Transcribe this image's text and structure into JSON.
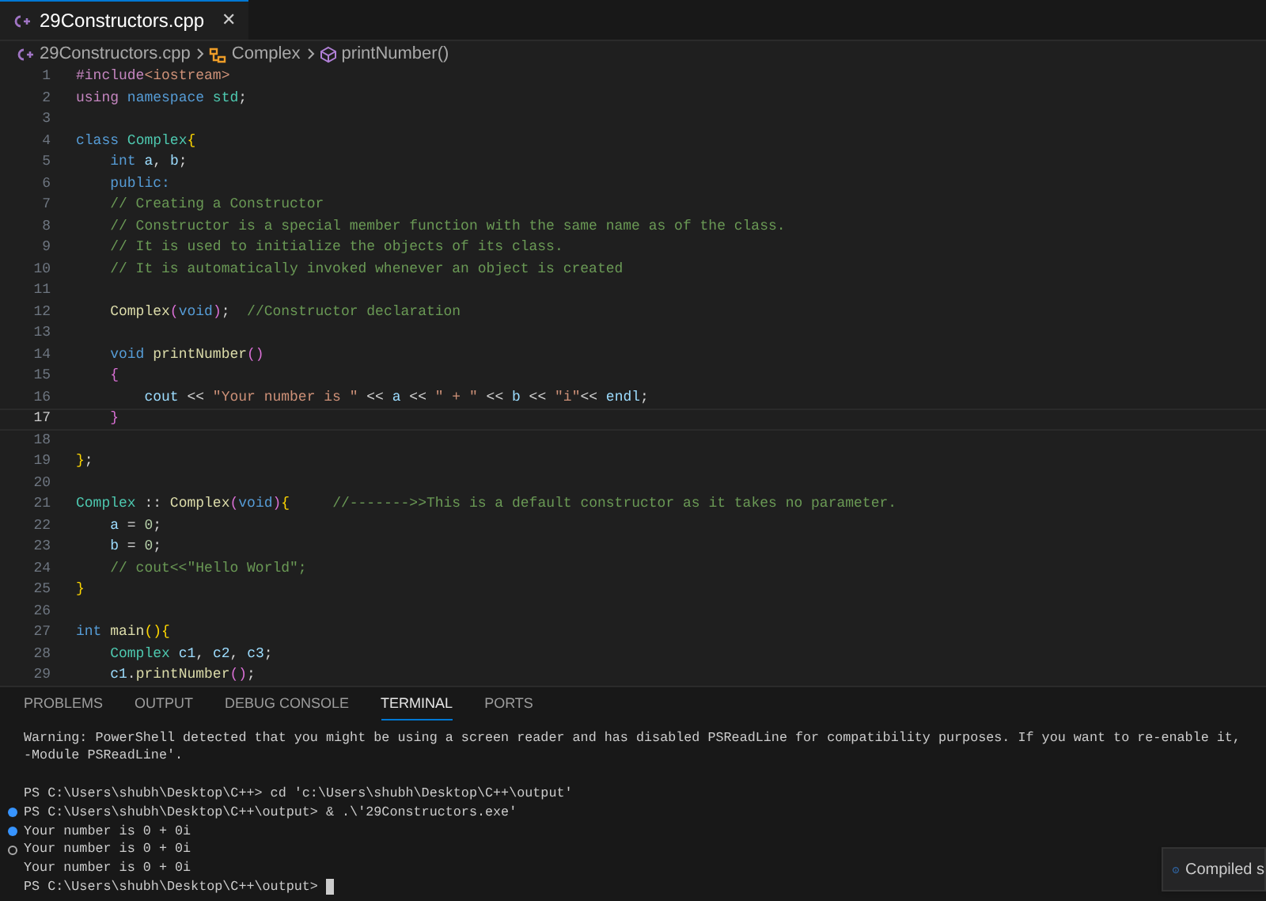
{
  "tab": {
    "label": "29Constructors.cpp",
    "close": "✕",
    "selected": true
  },
  "breadcrumb": [
    {
      "label": "29Constructors.cpp",
      "kind": "file"
    },
    {
      "label": "Complex",
      "kind": "class"
    },
    {
      "label": "printNumber()",
      "kind": "method"
    }
  ],
  "editor": {
    "lines": [
      {
        "number": "1",
        "active": false,
        "tokens": [
          {
            "text": "#include",
            "kind": "control"
          },
          {
            "text": "<iostream>",
            "kind": "string"
          }
        ]
      },
      {
        "number": "2",
        "active": false,
        "tokens": [
          {
            "text": "using",
            "kind": "control"
          },
          {
            "text": " namespace",
            "kind": "keyword"
          },
          {
            "text": " std",
            "kind": "type"
          },
          {
            "text": ";",
            "kind": "plain"
          }
        ]
      },
      {
        "number": "3",
        "active": false
      },
      {
        "number": "4",
        "active": false,
        "tokens": [
          {
            "text": "class",
            "kind": "keyword"
          },
          {
            "text": " Complex",
            "kind": "type"
          },
          {
            "text": "{",
            "kind": "bracket"
          }
        ]
      },
      {
        "number": "5",
        "active": false,
        "tokens": [
          {
            "text": "    int",
            "kind": "keyword"
          },
          {
            "text": " a",
            "kind": "var"
          },
          {
            "text": ", ",
            "kind": "plain"
          },
          {
            "text": "b",
            "kind": "var"
          },
          {
            "text": ";",
            "kind": "plain"
          }
        ]
      },
      {
        "number": "6",
        "active": false,
        "tokens": [
          {
            "text": "    public:",
            "kind": "keyword"
          }
        ]
      },
      {
        "number": "7",
        "active": false,
        "tokens": [
          {
            "text": "    // Creating a Constructor",
            "kind": "comment"
          }
        ]
      },
      {
        "number": "8",
        "active": false,
        "tokens": [
          {
            "text": "    // Constructor is a special member function with the same name as of the class.",
            "kind": "comment"
          }
        ]
      },
      {
        "number": "9",
        "active": false,
        "tokens": [
          {
            "text": "    // It is used to initialize the objects of its class.",
            "kind": "comment"
          }
        ]
      },
      {
        "number": "10",
        "active": false,
        "tokens": [
          {
            "text": "    // It is automatically invoked whenever an object is created",
            "kind": "comment"
          }
        ]
      },
      {
        "number": "11",
        "active": false
      },
      {
        "number": "12",
        "active": false,
        "tokens": [
          {
            "text": "    Complex",
            "kind": "func"
          },
          {
            "text": "(",
            "kind": "bracket2"
          },
          {
            "text": "void",
            "kind": "keyword"
          },
          {
            "text": ")",
            "kind": "bracket2"
          },
          {
            "text": ";  ",
            "kind": "plain"
          },
          {
            "text": "//Constructor declaration",
            "kind": "comment"
          }
        ]
      },
      {
        "number": "13",
        "active": false
      },
      {
        "number": "14",
        "active": false,
        "tokens": [
          {
            "text": "    void",
            "kind": "keyword"
          },
          {
            "text": " printNumber",
            "kind": "func"
          },
          {
            "text": "()",
            "kind": "bracket2"
          }
        ]
      },
      {
        "number": "15",
        "active": false,
        "tokens": [
          {
            "text": "    {",
            "kind": "bracket2"
          }
        ]
      },
      {
        "number": "16",
        "active": false,
        "tokens": [
          {
            "text": "        cout",
            "kind": "var"
          },
          {
            "text": " << ",
            "kind": "plain"
          },
          {
            "text": "\"Your number is \"",
            "kind": "string"
          },
          {
            "text": " << ",
            "kind": "plain"
          },
          {
            "text": "a",
            "kind": "var"
          },
          {
            "text": " << ",
            "kind": "plain"
          },
          {
            "text": "\" + \"",
            "kind": "string"
          },
          {
            "text": " << ",
            "kind": "plain"
          },
          {
            "text": "b",
            "kind": "var"
          },
          {
            "text": " << ",
            "kind": "plain"
          },
          {
            "text": "\"i\"",
            "kind": "string"
          },
          {
            "text": "<< ",
            "kind": "plain"
          },
          {
            "text": "endl",
            "kind": "var"
          },
          {
            "text": ";",
            "kind": "plain"
          }
        ]
      },
      {
        "number": "17",
        "active": true,
        "tokens": [
          {
            "text": "    }",
            "kind": "bracket2"
          }
        ]
      },
      {
        "number": "18",
        "active": false
      },
      {
        "number": "19",
        "active": false,
        "tokens": [
          {
            "text": "}",
            "kind": "bracket"
          },
          {
            "text": ";",
            "kind": "plain"
          }
        ]
      },
      {
        "number": "20",
        "active": false
      },
      {
        "number": "21",
        "active": false,
        "tokens": [
          {
            "text": "Complex",
            "kind": "type"
          },
          {
            "text": " :: ",
            "kind": "plain"
          },
          {
            "text": "Complex",
            "kind": "func"
          },
          {
            "text": "(",
            "kind": "bracket2"
          },
          {
            "text": "void",
            "kind": "keyword"
          },
          {
            "text": ")",
            "kind": "bracket2"
          },
          {
            "text": "{",
            "kind": "bracket"
          },
          {
            "text": "     //------->>This is a default constructor as it takes no parameter.",
            "kind": "comment"
          }
        ]
      },
      {
        "number": "22",
        "active": false,
        "tokens": [
          {
            "text": "    a",
            "kind": "var"
          },
          {
            "text": " = ",
            "kind": "plain"
          },
          {
            "text": "0",
            "kind": "number"
          },
          {
            "text": ";",
            "kind": "plain"
          }
        ]
      },
      {
        "number": "23",
        "active": false,
        "tokens": [
          {
            "text": "    b",
            "kind": "var"
          },
          {
            "text": " = ",
            "kind": "plain"
          },
          {
            "text": "0",
            "kind": "number"
          },
          {
            "text": ";",
            "kind": "plain"
          }
        ]
      },
      {
        "number": "24",
        "active": false,
        "tokens": [
          {
            "text": "    // cout<<\"Hello World\";",
            "kind": "comment"
          }
        ]
      },
      {
        "number": "25",
        "active": false,
        "tokens": [
          {
            "text": "}",
            "kind": "bracket"
          }
        ]
      },
      {
        "number": "26",
        "active": false
      },
      {
        "number": "27",
        "active": false,
        "tokens": [
          {
            "text": "int",
            "kind": "keyword"
          },
          {
            "text": " main",
            "kind": "func"
          },
          {
            "text": "(){",
            "kind": "bracket"
          }
        ]
      },
      {
        "number": "28",
        "active": false,
        "tokens": [
          {
            "text": "    Complex",
            "kind": "type"
          },
          {
            "text": " c1",
            "kind": "var"
          },
          {
            "text": ", ",
            "kind": "plain"
          },
          {
            "text": "c2",
            "kind": "var"
          },
          {
            "text": ", ",
            "kind": "plain"
          },
          {
            "text": "c3",
            "kind": "var"
          },
          {
            "text": ";",
            "kind": "plain"
          }
        ]
      },
      {
        "number": "29",
        "active": false,
        "tokens": [
          {
            "text": "    c1",
            "kind": "var"
          },
          {
            "text": ".",
            "kind": "plain"
          },
          {
            "text": "printNumber",
            "kind": "func"
          },
          {
            "text": "()",
            "kind": "bracket2"
          },
          {
            "text": ";",
            "kind": "plain"
          }
        ]
      }
    ]
  },
  "panel_tabs": [
    {
      "label": "PROBLEMS",
      "selected": false
    },
    {
      "label": "OUTPUT",
      "selected": false
    },
    {
      "label": "DEBUG CONSOLE",
      "selected": false
    },
    {
      "label": "TERMINAL",
      "selected": true
    },
    {
      "label": "PORTS",
      "selected": false
    }
  ],
  "terminal": {
    "lines": [
      {
        "text": "Warning: PowerShell detected that you might be using a screen reader and has disabled PSReadLine for compatibility purposes. If you want to re-enable it,"
      },
      {
        "text": "-Module PSReadLine'."
      },
      {
        "spaced": true,
        "text": "PS C:\\Users\\shubh\\Desktop\\C++> cd 'c:\\Users\\shubh\\Desktop\\C++\\output'"
      },
      {
        "text": "PS C:\\Users\\shubh\\Desktop\\C++\\output> & .\\'29Constructors.exe'",
        "dot": {
          "filled": true
        }
      },
      {
        "text": "Your number is 0 + 0i",
        "dot": {
          "filled": true
        }
      },
      {
        "text": "Your number is 0 + 0i",
        "dot": {
          "filled": false
        }
      },
      {
        "text": "Your number is 0 + 0i"
      },
      {
        "text": "PS C:\\Users\\shubh\\Desktop\\C++\\output>",
        "cursor": true
      }
    ]
  },
  "notification": {
    "text": "Compiled s"
  }
}
